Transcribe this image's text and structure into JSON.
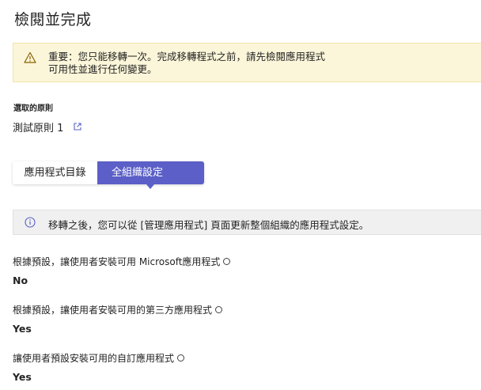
{
  "page": {
    "title": "檢閱並完成"
  },
  "warning": {
    "icon": "warning-icon",
    "line1": "重要：您只能移轉一次。完成移轉程式之前，請先檢閱應用程式",
    "line2": "可用性並進行任何變更。"
  },
  "policy": {
    "section_label": "選取的原則",
    "name": "測試原則 1",
    "open_icon": "open-in-new-icon"
  },
  "tabs": [
    {
      "label": "應用程式目錄",
      "active": false
    },
    {
      "label": "全組織設定",
      "active": true
    }
  ],
  "info": {
    "icon": "info-icon",
    "text": "移轉之後，您可以從 [管理應用程式] 頁面更新整個組織的應用程式設定。"
  },
  "settings": [
    {
      "label": "根據預設，讓使用者安裝可用 Microsoft應用程式",
      "value": "No"
    },
    {
      "label": "根據預設，讓使用者安裝可用的第三方應用程式",
      "value": "Yes"
    },
    {
      "label": "讓使用者預設安裝可用的自訂應用程式",
      "value": "Yes"
    }
  ],
  "colors": {
    "accent": "#5b5fc7",
    "warning_bg": "#fbf6d9",
    "info_bg": "#f0f0f0"
  }
}
